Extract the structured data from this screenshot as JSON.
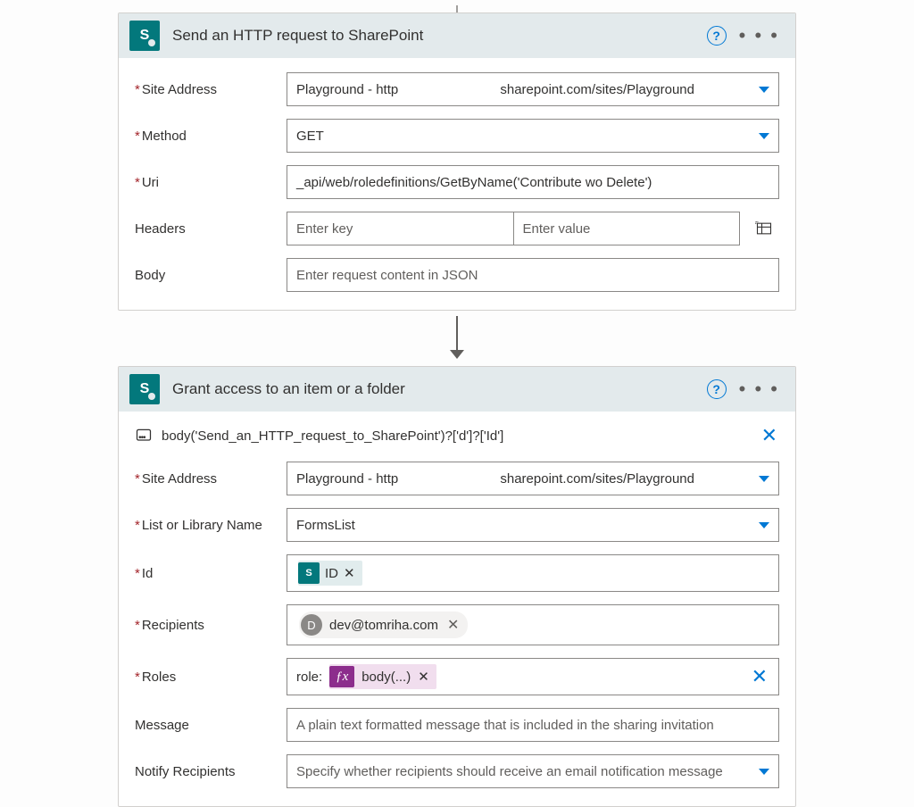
{
  "card1": {
    "title": "Send an HTTP request to SharePoint",
    "labels": {
      "siteAddress": "Site Address",
      "method": "Method",
      "uri": "Uri",
      "headers": "Headers",
      "body": "Body"
    },
    "values": {
      "siteAddress_left": "Playground - http",
      "siteAddress_right": "sharepoint.com/sites/Playground",
      "method": "GET",
      "uri": "_api/web/roledefinitions/GetByName('Contribute wo Delete')"
    },
    "placeholders": {
      "headerKey": "Enter key",
      "headerValue": "Enter value",
      "body": "Enter request content in JSON"
    }
  },
  "card2": {
    "title": "Grant access to an item or a folder",
    "peekExpression": "body('Send_an_HTTP_request_to_SharePoint')?['d']?['Id']",
    "labels": {
      "siteAddress": "Site Address",
      "list": "List or Library Name",
      "id": "Id",
      "recipients": "Recipients",
      "roles": "Roles",
      "message": "Message",
      "notify": "Notify Recipients"
    },
    "values": {
      "siteAddress_left": "Playground - http",
      "siteAddress_right": "sharepoint.com/sites/Playground",
      "list": "FormsList",
      "idToken": "ID",
      "recipientInitial": "D",
      "recipientEmail": "dev@tomriha.com",
      "rolesPrefix": "role:",
      "rolesToken": "body(...)"
    },
    "placeholders": {
      "message": "A plain text formatted message that is included in the sharing invitation",
      "notify": "Specify whether recipients should receive an email notification message"
    }
  },
  "icons": {
    "spLetter": "S",
    "help": "?",
    "ellipsis": "• • •",
    "fx": "ƒx"
  }
}
